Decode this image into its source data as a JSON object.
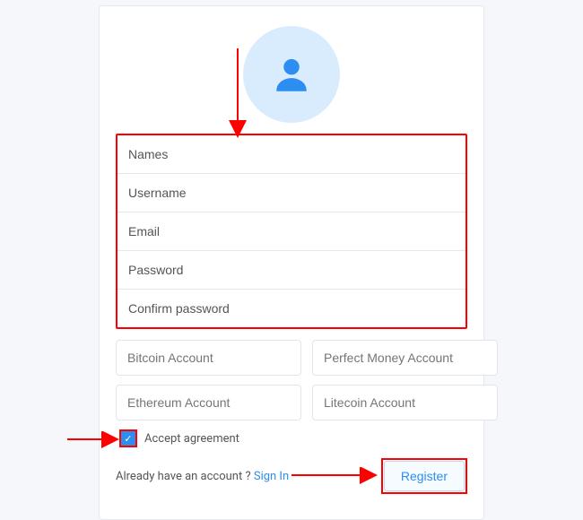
{
  "form": {
    "names": {
      "placeholder": "Names",
      "value": ""
    },
    "username": {
      "placeholder": "Username",
      "value": ""
    },
    "email": {
      "placeholder": "Email",
      "value": ""
    },
    "password": {
      "placeholder": "Password",
      "value": ""
    },
    "confirm_password": {
      "placeholder": "Confirm password",
      "value": ""
    }
  },
  "accounts": {
    "bitcoin": {
      "placeholder": "Bitcoin Account",
      "value": ""
    },
    "perfect_money": {
      "placeholder": "Perfect Money Account",
      "value": ""
    },
    "ethereum": {
      "placeholder": "Ethereum Account",
      "value": ""
    },
    "litecoin": {
      "placeholder": "Litecoin Account",
      "value": ""
    }
  },
  "agreement": {
    "label": "Accept agreement",
    "checked": true
  },
  "footer": {
    "already_text": "Already have an account ? ",
    "signin_label": "Sign In",
    "register_label": "Register"
  },
  "colors": {
    "primary": "#2b8ef0",
    "avatar_bg": "#d9ecfe",
    "annotation": "#ff0000"
  }
}
